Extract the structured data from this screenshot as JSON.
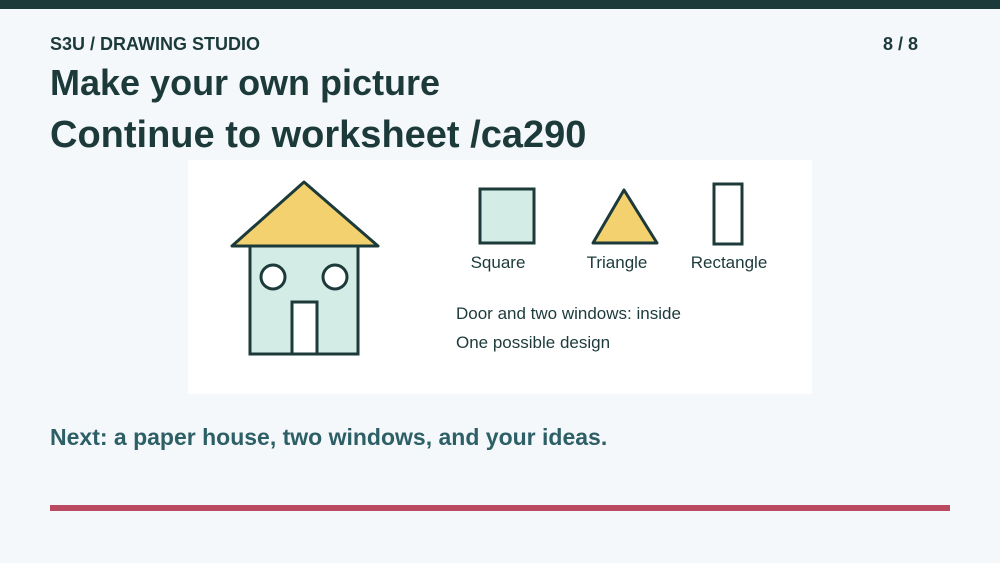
{
  "header": {
    "course": "S3U / DRAWING STUDIO",
    "page": "8 / 8"
  },
  "slide": {
    "title": "Make your own picture",
    "subtitle": "Continue to worksheet /ca290",
    "next": "Next: a paper house, two windows, and your ideas."
  },
  "diagram": {
    "shapes": [
      {
        "name": "Square",
        "icon": "square-icon"
      },
      {
        "name": "Triangle",
        "icon": "triangle-icon"
      },
      {
        "name": "Rectangle",
        "icon": "rectangle-icon"
      }
    ],
    "notes": [
      "Door and two windows: inside",
      "One possible design"
    ]
  },
  "colors": {
    "dark": "#1c3a3a",
    "roof": "#f4d16f",
    "wall": "#d4ece6",
    "accent": "#b94a60",
    "next_text": "#2d5f66"
  }
}
